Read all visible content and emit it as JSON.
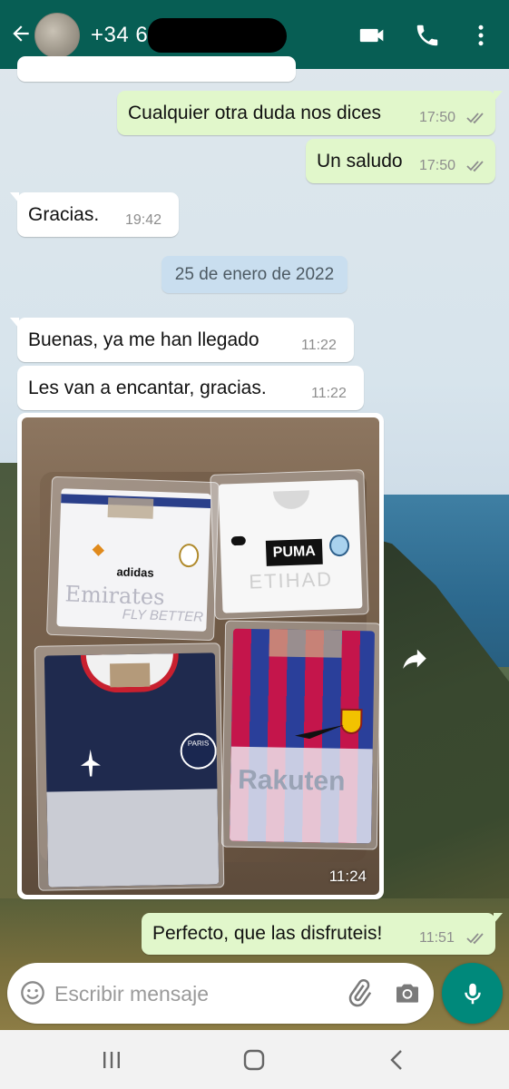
{
  "header": {
    "contact_name": "+34 6",
    "icons": [
      "back-arrow-icon",
      "avatar",
      "video-call-icon",
      "phone-icon",
      "more-vert-icon"
    ],
    "color": "#075e54"
  },
  "messages": [
    {
      "id": "m1",
      "direction": "outgoing",
      "text": "Cualquier otra duda nos dices",
      "time": "17:50",
      "status": "read"
    },
    {
      "id": "m2",
      "direction": "outgoing",
      "text": "Un saludo",
      "time": "17:50",
      "status": "read"
    },
    {
      "id": "m3",
      "direction": "incoming",
      "text": "Gracias.",
      "time": "19:42"
    },
    {
      "id": "m4",
      "direction": "incoming",
      "text": "Buenas, ya me han llegado",
      "time": "11:22"
    },
    {
      "id": "m5",
      "direction": "incoming",
      "text": "Les van a encantar, gracias.",
      "time": "11:22"
    },
    {
      "id": "m6",
      "direction": "incoming",
      "type": "image",
      "time": "11:24"
    },
    {
      "id": "m7",
      "direction": "outgoing",
      "text": "Perfecto, que las disfruteis!",
      "time": "11:51",
      "status": "read"
    }
  ],
  "date_separator": "25 de enero de 2022",
  "photo": {
    "shirt_texts": {
      "real_madrid_sponsor": "Emirates",
      "real_madrid_slogan": "FLY BETTER",
      "real_madrid_brand": "adidas",
      "city_brand": "PUMA",
      "city_sponsor": "ETIHAD",
      "psg_name": "PARIS",
      "barca_sponsor": "Rakuten"
    }
  },
  "input": {
    "placeholder": "Escribir mensaje",
    "icons": [
      "emoji-icon",
      "attach-icon",
      "camera-icon",
      "mic-icon"
    ]
  },
  "colors": {
    "outgoing_bubble": "#e1f7cb",
    "incoming_bubble": "#ffffff",
    "date_chip": "#c9deef",
    "mic_button": "#00897b",
    "read_ticks": "#8d8d8d"
  },
  "navbar": {
    "icons": [
      "recents-icon",
      "home-icon",
      "back-icon"
    ]
  }
}
